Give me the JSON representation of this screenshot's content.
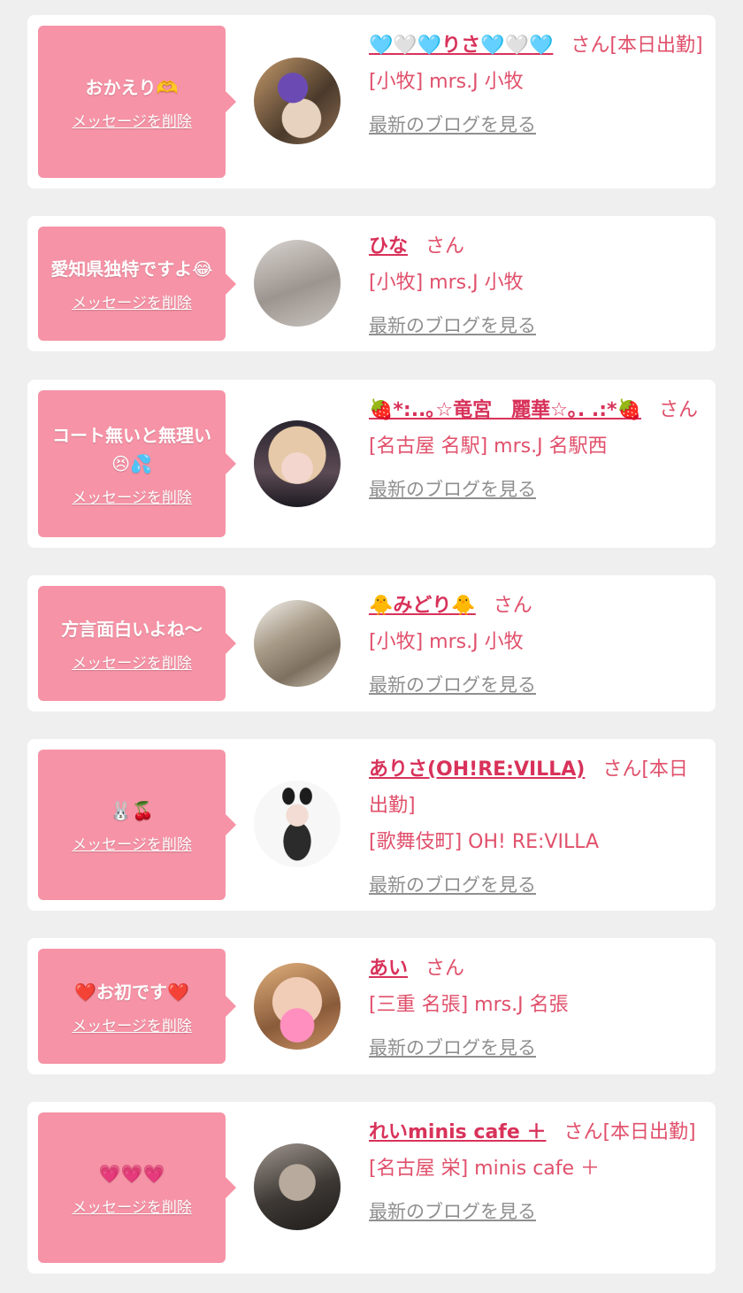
{
  "delete_label": "メッセージを削除",
  "blog_label": "最新のブログを見る",
  "name_suffix": "さん",
  "colors": {
    "page_bg": "#efefef",
    "bubble": "#f693a6",
    "name": "#d8325a",
    "text": "#e0506b",
    "link_gray": "#8f8f8f"
  },
  "cards": [
    {
      "message": "おかえり🫶",
      "name": "🩵🤍🩵りさ🩵🤍🩵",
      "status": "さん[本日出勤]",
      "shop": "[小牧] mrs.J 小牧"
    },
    {
      "message": "愛知県独特ですよ😂",
      "name": "ひな",
      "status": "さん",
      "shop": "[小牧] mrs.J 小牧"
    },
    {
      "message": "コート無いと無理い😣💦",
      "name": "🍓*:..｡☆竜宮　麗華☆｡. .:*🍓",
      "status": "さん",
      "shop": "[名古屋 名駅] mrs.J 名駅西"
    },
    {
      "message": "方言面白いよね〜",
      "name": "🐥みどり🐥",
      "status": "さん",
      "shop": "[小牧] mrs.J 小牧"
    },
    {
      "message": "🐰🍒",
      "name": "ありさ(OH!RE:VILLA)",
      "status": "さん[本日出勤]",
      "shop": "[歌舞伎町] OH! RE:VILLA"
    },
    {
      "message": "❤️お初です❤️",
      "name": "あい",
      "status": "さん",
      "shop": "[三重 名張] mrs.J 名張"
    },
    {
      "message": "💗💗💗",
      "name": "れいminis cafe ＋",
      "status": "さん[本日出勤]",
      "shop": "[名古屋 栄] minis cafe ＋"
    }
  ]
}
